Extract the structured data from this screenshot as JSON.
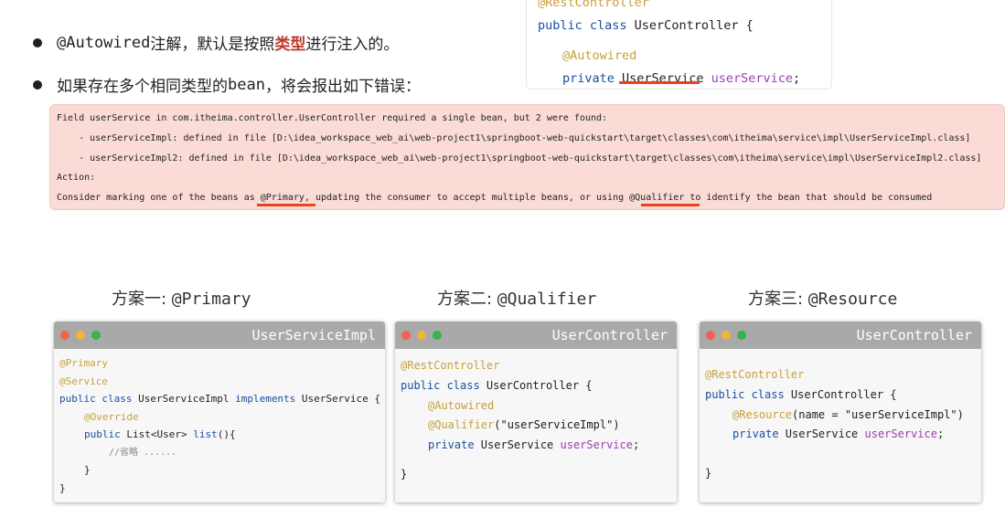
{
  "bullets": {
    "b1_prefix": "@Autowired",
    "b1_mid": "注解，默认是按照",
    "b1_hl": "类型",
    "b1_suffix": "进行注入的。",
    "b2_prefix": "如果存在多个相同类型的",
    "b2_mono": "bean",
    "b2_suffix": "，将会报出如下错误："
  },
  "top_code": {
    "line0": "@RestController",
    "line1_kw": "public class",
    "line1_rest": " UserController {",
    "line2": "@Autowired",
    "line3_kw": "private",
    "line3_type": "UserService",
    "line3_var": "userService",
    "line3_end": ";"
  },
  "error": {
    "l1": "Field userService in com.itheima.controller.UserController required a single bean, but 2 were found:",
    "l2": "    - userServiceImpl: defined in file [D:\\idea_workspace_web_ai\\web-project1\\springboot-web-quickstart\\target\\classes\\com\\itheima\\service\\impl\\UserServiceImpl.class]",
    "l3": "    - userServiceImpl2: defined in file [D:\\idea_workspace_web_ai\\web-project1\\springboot-web-quickstart\\target\\classes\\com\\itheima\\service\\impl\\UserServiceImpl2.class]",
    "l4": "Action:",
    "l5": "Consider marking one of the beans as @Primary, updating the consumer to accept multiple beans, or using @Qualifier to identify the bean that should be consumed"
  },
  "plans": [
    {
      "title_cn": "方案一: ",
      "title_code": "@Primary"
    },
    {
      "title_cn": "方案二: ",
      "title_code": "@Qualifier"
    },
    {
      "title_cn": "方案三: ",
      "title_code": "@Resource"
    }
  ],
  "windows": [
    {
      "title": "UserServiceImpl",
      "lines": [
        "@Primary",
        "@Service",
        "public class UserServiceImpl implements UserService {",
        "@Override",
        "public List<User> list(){",
        "//省略 ......",
        "}",
        "}"
      ]
    },
    {
      "title": "UserController",
      "lines": [
        "@RestController",
        "public class UserController {",
        "@Autowired",
        "@Qualifier(\"userServiceImpl\")",
        "private UserService userService;",
        "}"
      ]
    },
    {
      "title": "UserController",
      "lines": [
        "@RestController",
        "public class UserController {",
        "@Resource(name = \"userServiceImpl\")",
        "private UserService userService;",
        "}"
      ]
    }
  ],
  "colors": {
    "highlight": "#c0392b",
    "underline": "#e8441f",
    "annotation": "#c8a03c",
    "keyword": "#1a4fa0",
    "field": "#9a3fb5",
    "error_bg": "#fadbd6",
    "titlebar": "#a9a9a9"
  }
}
